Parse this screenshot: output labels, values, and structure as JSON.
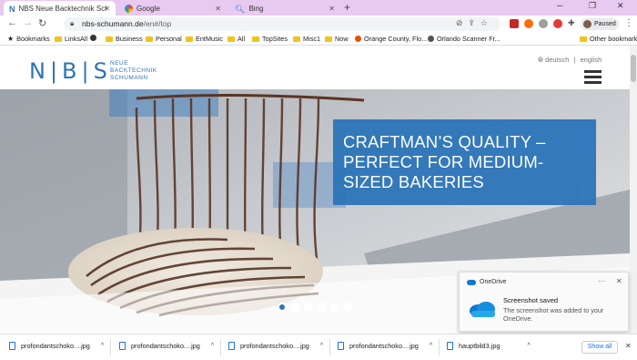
{
  "browser": {
    "tabs": [
      {
        "title": "NBS Neue Backtechnik Schumann",
        "active": true,
        "icon": "nbs-favicon"
      },
      {
        "title": "Google",
        "active": false,
        "icon": "google-favicon"
      },
      {
        "title": "Bing",
        "active": false,
        "icon": "bing-favicon"
      }
    ],
    "new_tab": "+",
    "url_host": "nbs-schumann.de",
    "url_path": "/en#/top",
    "profile_status": "Paused",
    "bookmarks": [
      {
        "label": "Bookmarks",
        "kind": "star"
      },
      {
        "label": "LinksAll",
        "kind": "folder"
      },
      {
        "label": "",
        "kind": "globe"
      },
      {
        "label": "Business",
        "kind": "folder"
      },
      {
        "label": "Personal",
        "kind": "folder"
      },
      {
        "label": "EntMusic",
        "kind": "folder"
      },
      {
        "label": "All",
        "kind": "folder"
      },
      {
        "label": "TopSites",
        "kind": "folder"
      },
      {
        "label": "Misc1",
        "kind": "folder"
      },
      {
        "label": "Now",
        "kind": "folder"
      },
      {
        "label": "Orange County, Flo...",
        "kind": "site"
      },
      {
        "label": "Orlando Scanner Fr...",
        "kind": "site"
      },
      {
        "label": "Other bookmarks",
        "kind": "folder"
      }
    ]
  },
  "site": {
    "logo_letters": [
      "N",
      "B",
      "S"
    ],
    "logo_subtitle": [
      "NEUE",
      "BACKTECHNIK",
      "SCHUMANN"
    ],
    "lang_de": "deutsch",
    "lang_sep": "|",
    "lang_en": "english",
    "headline": "CRAFTMAN’S QUALITY – PERFECT FOR MEDIUM-SIZED BAKERIES",
    "slider_dots": 6,
    "slider_active": 0
  },
  "toast": {
    "app": "OneDrive",
    "more": "···",
    "close": "✕",
    "title": "Screenshot saved",
    "body": "The screenshot was added to your OneDrive."
  },
  "downloads": {
    "items": [
      "profondantschoko....jpg",
      "profondantschoko....jpg",
      "profondantschoko....jpg",
      "profondantschoko....jpg",
      "hauptbild3.jpg"
    ],
    "show_all": "Show all",
    "close": "✕"
  },
  "colors": {
    "brand_blue": "#2e76b9",
    "tabstrip": "#e8c9ef"
  }
}
